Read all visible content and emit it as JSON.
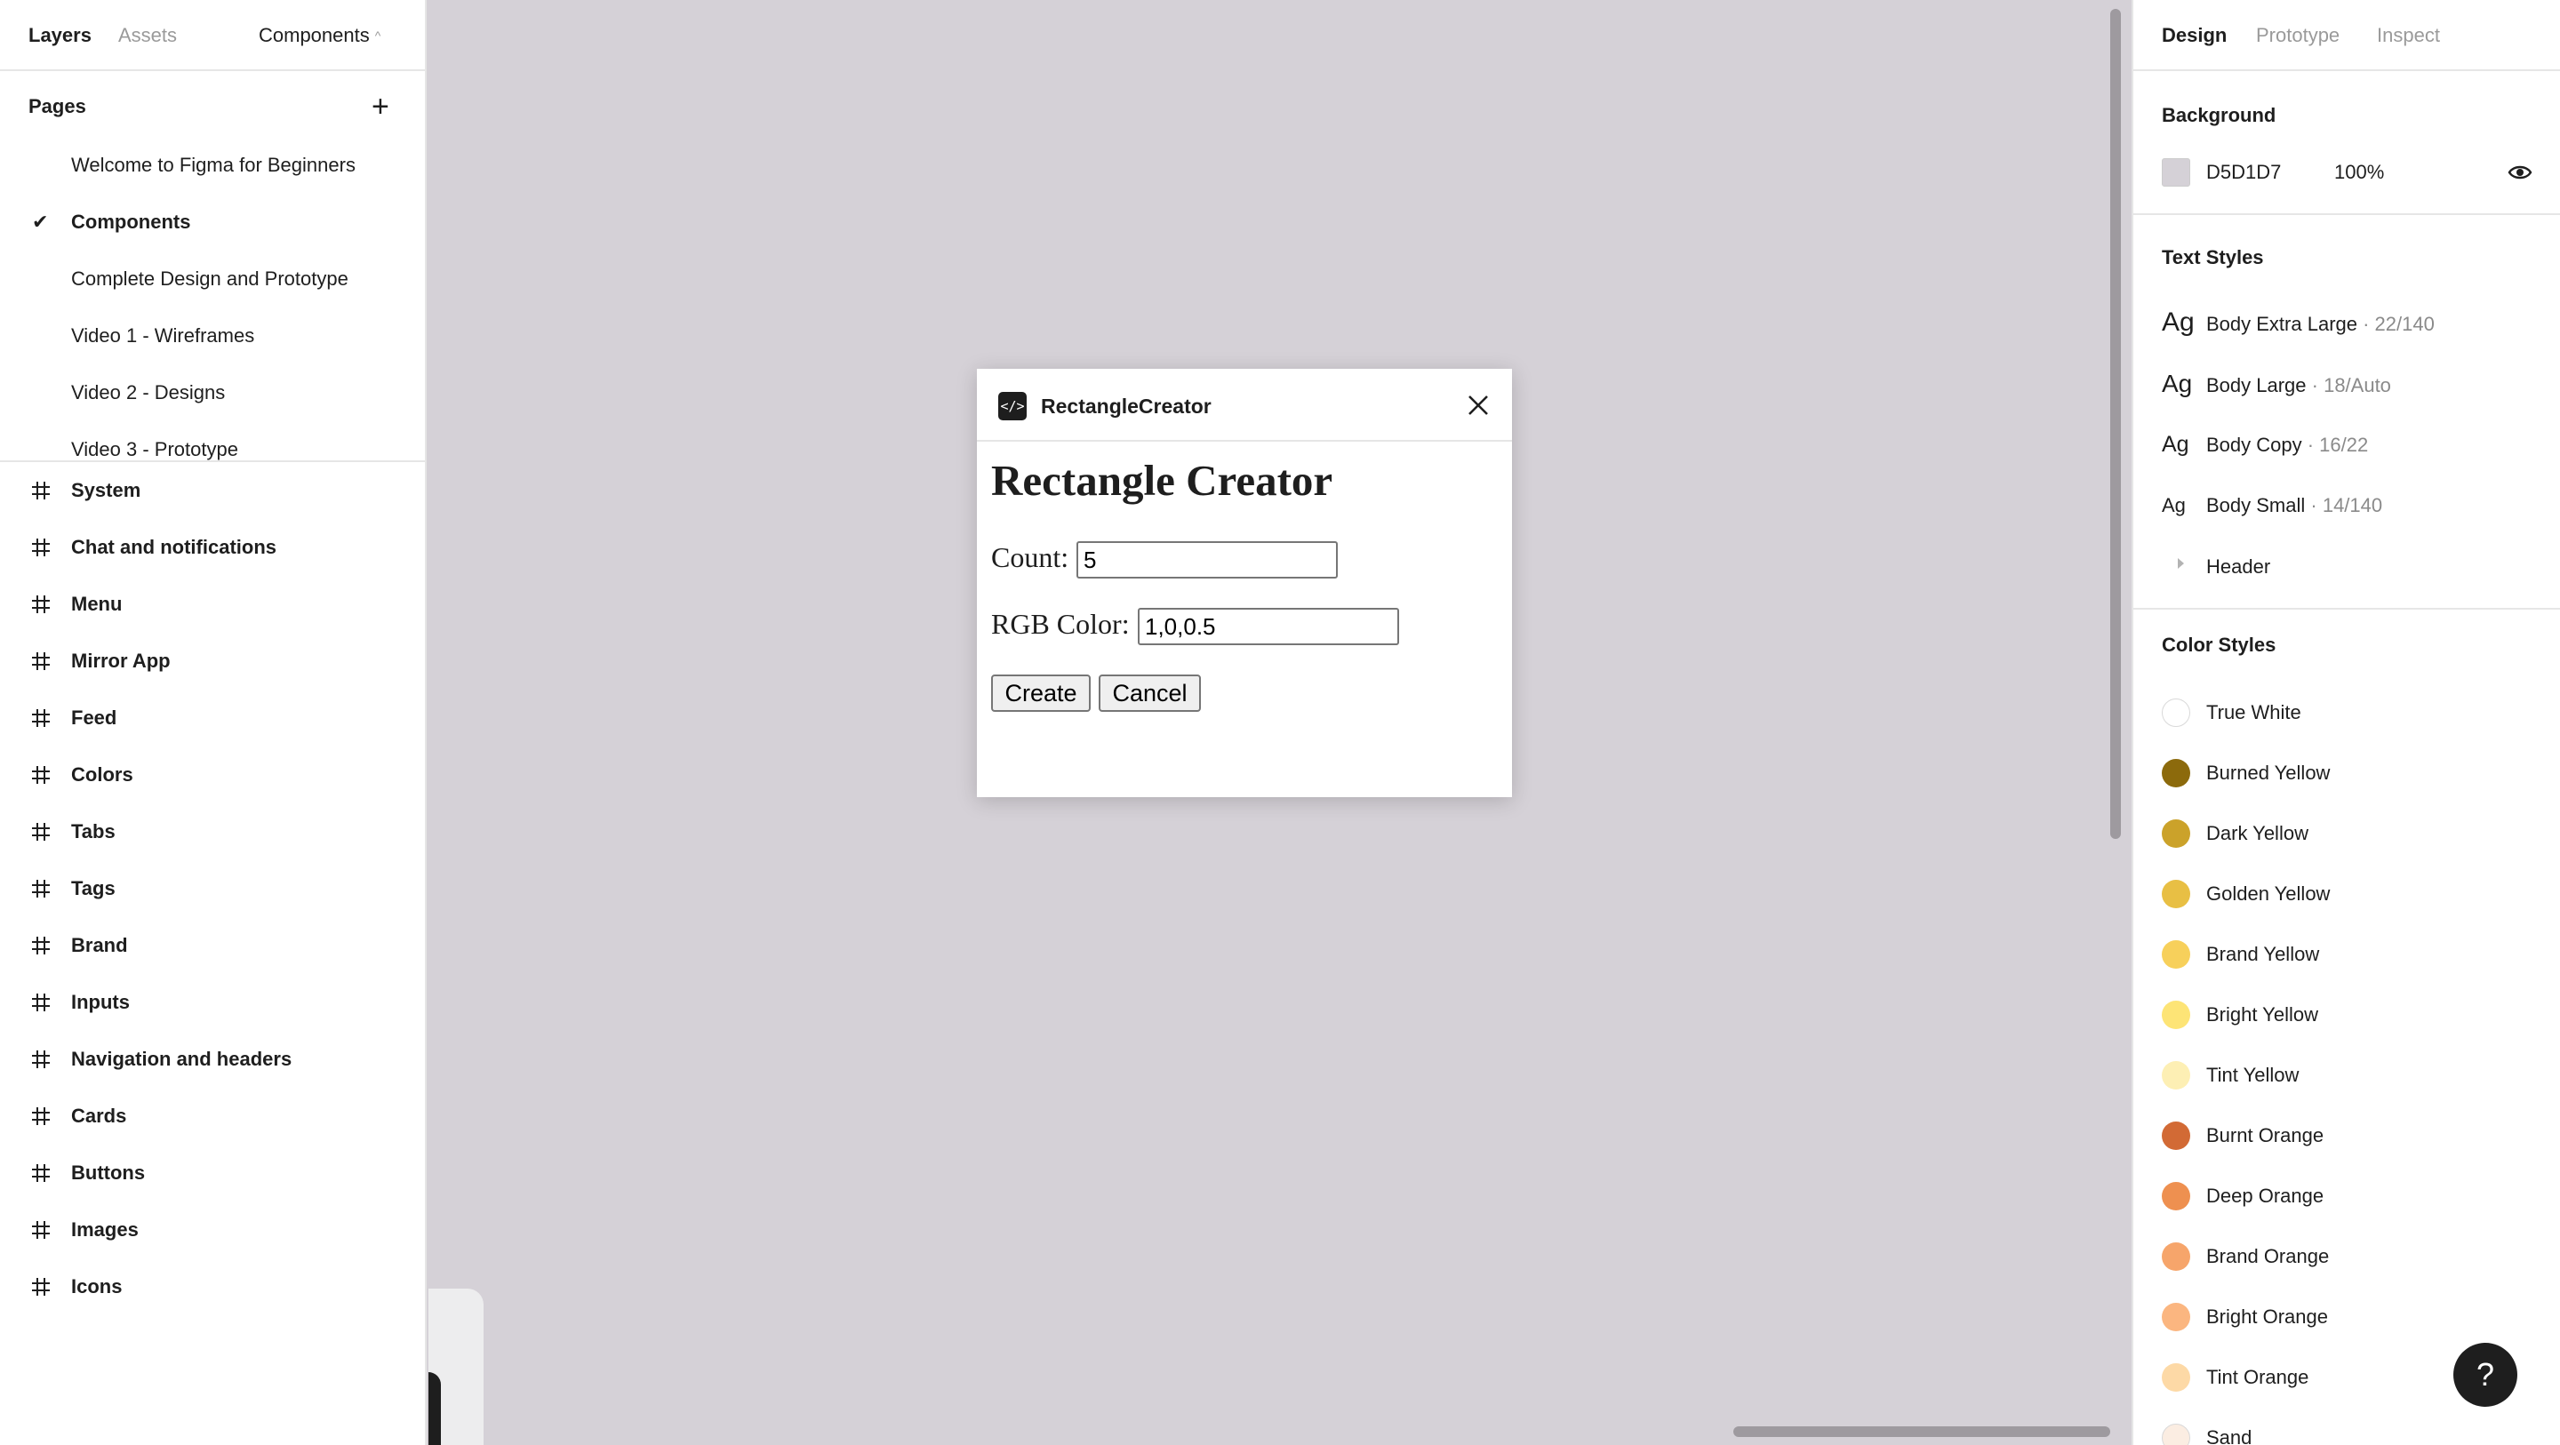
{
  "left_panel": {
    "tabs": {
      "layers": "Layers",
      "assets": "Assets"
    },
    "current_page": "Components",
    "pages_header": "Pages",
    "pages": [
      "Welcome to Figma for Beginners",
      "Components",
      "Complete Design and Prototype",
      "Video 1 - Wireframes",
      "Video 2 - Designs",
      "Video 3 - Prototype"
    ],
    "frames": [
      "System",
      "Chat and notifications",
      "Menu",
      "Mirror App",
      "Feed",
      "Colors",
      "Tabs",
      "Tags",
      "Brand",
      "Inputs",
      "Navigation and headers",
      "Cards",
      "Buttons",
      "Images",
      "Icons"
    ]
  },
  "dialog": {
    "title": "RectangleCreator",
    "heading": "Rectangle Creator",
    "count_label": "Count:",
    "count_value": "5",
    "rgb_label": "RGB Color:",
    "rgb_value": "1,0,0.5",
    "create_label": "Create",
    "cancel_label": "Cancel"
  },
  "right_panel": {
    "tabs": {
      "design": "Design",
      "prototype": "Prototype",
      "inspect": "Inspect"
    },
    "background": {
      "header": "Background",
      "hex": "D5D1D7",
      "opacity": "100%",
      "color": "#D5D1D7"
    },
    "text_styles": {
      "header": "Text Styles",
      "items": [
        {
          "ag": "Ag",
          "name": "Body Extra Large",
          "meta": " · 22/140"
        },
        {
          "ag": "Ag",
          "name": "Body Large",
          "meta": " · 18/Auto"
        },
        {
          "ag": "Ag",
          "name": "Body Copy",
          "meta": " · 16/22"
        },
        {
          "ag": "Ag",
          "name": "Body Small",
          "meta": " · 14/140"
        }
      ],
      "group": "Header"
    },
    "color_styles": {
      "header": "Color Styles",
      "items": [
        {
          "name": "True White",
          "color": "#FFFFFF"
        },
        {
          "name": "Burned Yellow",
          "color": "#8C6A0C"
        },
        {
          "name": "Dark Yellow",
          "color": "#CBA22A"
        },
        {
          "name": "Golden Yellow",
          "color": "#E8BF44"
        },
        {
          "name": "Brand Yellow",
          "color": "#F7D05B"
        },
        {
          "name": "Bright Yellow",
          "color": "#FDE476"
        },
        {
          "name": "Tint Yellow",
          "color": "#FDEFB4"
        },
        {
          "name": "Burnt Orange",
          "color": "#D26A35"
        },
        {
          "name": "Deep Orange",
          "color": "#EE9050"
        },
        {
          "name": "Brand Orange",
          "color": "#F6A56B"
        },
        {
          "name": "Bright Orange",
          "color": "#FBB680"
        },
        {
          "name": "Tint Orange",
          "color": "#FDD9A6"
        },
        {
          "name": "Sand",
          "color": "#FBEDE2"
        }
      ]
    }
  },
  "help_label": "?"
}
